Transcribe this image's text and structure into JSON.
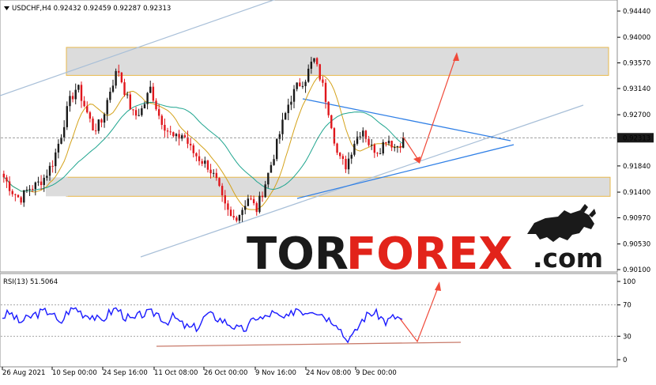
{
  "header": {
    "symbol_line": "USDCHF,H4  0.92432 0.92459 0.92287 0.92313",
    "rsi_label": "RSI(13) 51.5064"
  },
  "watermark": {
    "part1": "TOR",
    "part2": "FOREX",
    "part3": ".com"
  },
  "colors": {
    "bull_candle": "#1a1a1a",
    "bear_candle": "#e0161c",
    "ma_fast": "#d4a21a",
    "ma_slow": "#1fa58f",
    "zone_fill": "#dcdcdc",
    "zone_border": "#e8b84a",
    "channel_line": "#a8bfd8",
    "triangle_line": "#2f7fe6",
    "forecast_arrow": "#f04a3a",
    "rsi_line": "#1a1aff",
    "rsi_support": "#c87a6a",
    "price_marker_bg": "#1a1a1a",
    "watermark_text": "#1a1a1a",
    "watermark_accent": "#e2231a"
  },
  "chart_data": [
    {
      "type": "candlestick",
      "title": "USDCHF,H4",
      "ohlc_last": {
        "open": 0.92432,
        "high": 0.92459,
        "low": 0.92287,
        "close": 0.92313
      },
      "current_price_label": "0.92313",
      "ylim": [
        0.9,
        0.945
      ],
      "y_ticks": [
        "0.94440",
        "0.94000",
        "0.93570",
        "0.93140",
        "0.92700",
        "0.92313",
        "0.91840",
        "0.91400",
        "0.90970",
        "0.90530",
        "0.90100"
      ],
      "x_ticks": [
        "26 Aug 2021",
        "10 Sep 00:00",
        "24 Sep 16:00",
        "11 Oct 08:00",
        "26 Oct 00:00",
        "9 Nov 16:00",
        "24 Nov 08:00",
        "9 Dec 00:00"
      ],
      "price_path": [
        0.9165,
        0.9142,
        0.9128,
        0.9146,
        0.9152,
        0.9165,
        0.919,
        0.9235,
        0.929,
        0.9318,
        0.9281,
        0.9245,
        0.9258,
        0.931,
        0.9348,
        0.9302,
        0.9266,
        0.928,
        0.9315,
        0.927,
        0.9245,
        0.9228,
        0.9238,
        0.921,
        0.9196,
        0.9185,
        0.9161,
        0.9118,
        0.9094,
        0.9106,
        0.9132,
        0.911,
        0.9152,
        0.9196,
        0.9246,
        0.9292,
        0.9318,
        0.9331,
        0.9365,
        0.9325,
        0.9268,
        0.9198,
        0.9184,
        0.9225,
        0.9248,
        0.9215,
        0.921,
        0.9232,
        0.9215,
        0.9228
      ],
      "zones": [
        {
          "low": 0.9336,
          "high": 0.9383
        },
        {
          "low": 0.9133,
          "high": 0.9165
        }
      ],
      "moving_averages": [
        "fast",
        "slow"
      ],
      "grid": true
    },
    {
      "type": "line",
      "title": "RSI(13)",
      "current_value": 51.5064,
      "ylim": [
        0,
        100
      ],
      "y_ticks": [
        "100",
        "70",
        "30",
        "0"
      ],
      "levels": [
        70,
        30
      ],
      "values": [
        55,
        60,
        48,
        52,
        58,
        61,
        62,
        44,
        62,
        66,
        58,
        57,
        48,
        59,
        66,
        55,
        50,
        58,
        59,
        60,
        48,
        55,
        45,
        40,
        42,
        58,
        55,
        50,
        45,
        38,
        40,
        55,
        52,
        60,
        54,
        52,
        67,
        61,
        65,
        60,
        52,
        48,
        27,
        30,
        50,
        60,
        58,
        48,
        55,
        52
      ],
      "grid": true
    }
  ]
}
